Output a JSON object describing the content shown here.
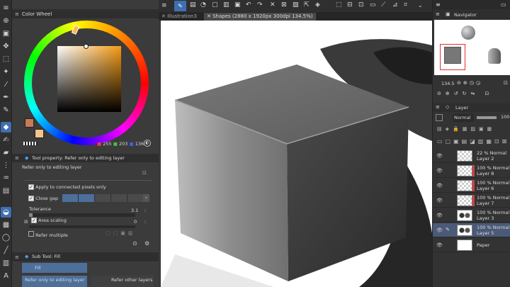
{
  "color_wheel": {
    "title": "Color Wheel",
    "rgb": {
      "r": "255",
      "g": "203",
      "b": "136"
    },
    "main_color": "#c97a58",
    "sub_color": "#f4c689"
  },
  "tool_property": {
    "title": "Tool property: Refer only to editing layer",
    "subtitle": "Refer only to editing layer",
    "apply_connected": "Apply to connected pixels only",
    "close_gap": "Close gap",
    "tolerance_label": "Tolerance",
    "tolerance_value": "3.1",
    "area_scaling_label": "Area scaling",
    "area_scaling_value": "0",
    "refer_multiple": "Refer multiple"
  },
  "sub_tool": {
    "title": "Sub Tool: Fill",
    "items": [
      "Fill",
      "Refer only to editing layer",
      "Refer other layers"
    ]
  },
  "tabs": [
    "Illustration3",
    "Shapes (2880 x 1920px 300dpi 134.5%)"
  ],
  "navigator": {
    "title": "Navigator",
    "zoom": "134.5"
  },
  "layer_panel": {
    "title": "Layer",
    "blend_mode": "Normal",
    "opacity": "100",
    "layers": [
      {
        "pct": "22 %  Normal",
        "name": "Layer 2",
        "marker": false,
        "thumb": "checker"
      },
      {
        "pct": "100 %  Normal",
        "name": "Layer 8",
        "marker": true,
        "thumb": "checker"
      },
      {
        "pct": "100 %  Normal",
        "name": "Layer 6",
        "marker": true,
        "thumb": "checker"
      },
      {
        "pct": "100 %  Normal",
        "name": "Layer 7",
        "marker": true,
        "thumb": "checker"
      },
      {
        "pct": "100 %  Normal",
        "name": "Layer 3",
        "marker": false,
        "thumb": "shapes"
      },
      {
        "pct": "100 %  Normal",
        "name": "Layer 5",
        "marker": false,
        "thumb": "shapes",
        "selected": true
      },
      {
        "pct": "",
        "name": "Paper",
        "marker": false,
        "thumb": "white"
      }
    ]
  },
  "colors": {
    "accent": "#3e6fb0",
    "layer_selected": "#4a5a78",
    "marker_red": "#d04040"
  }
}
